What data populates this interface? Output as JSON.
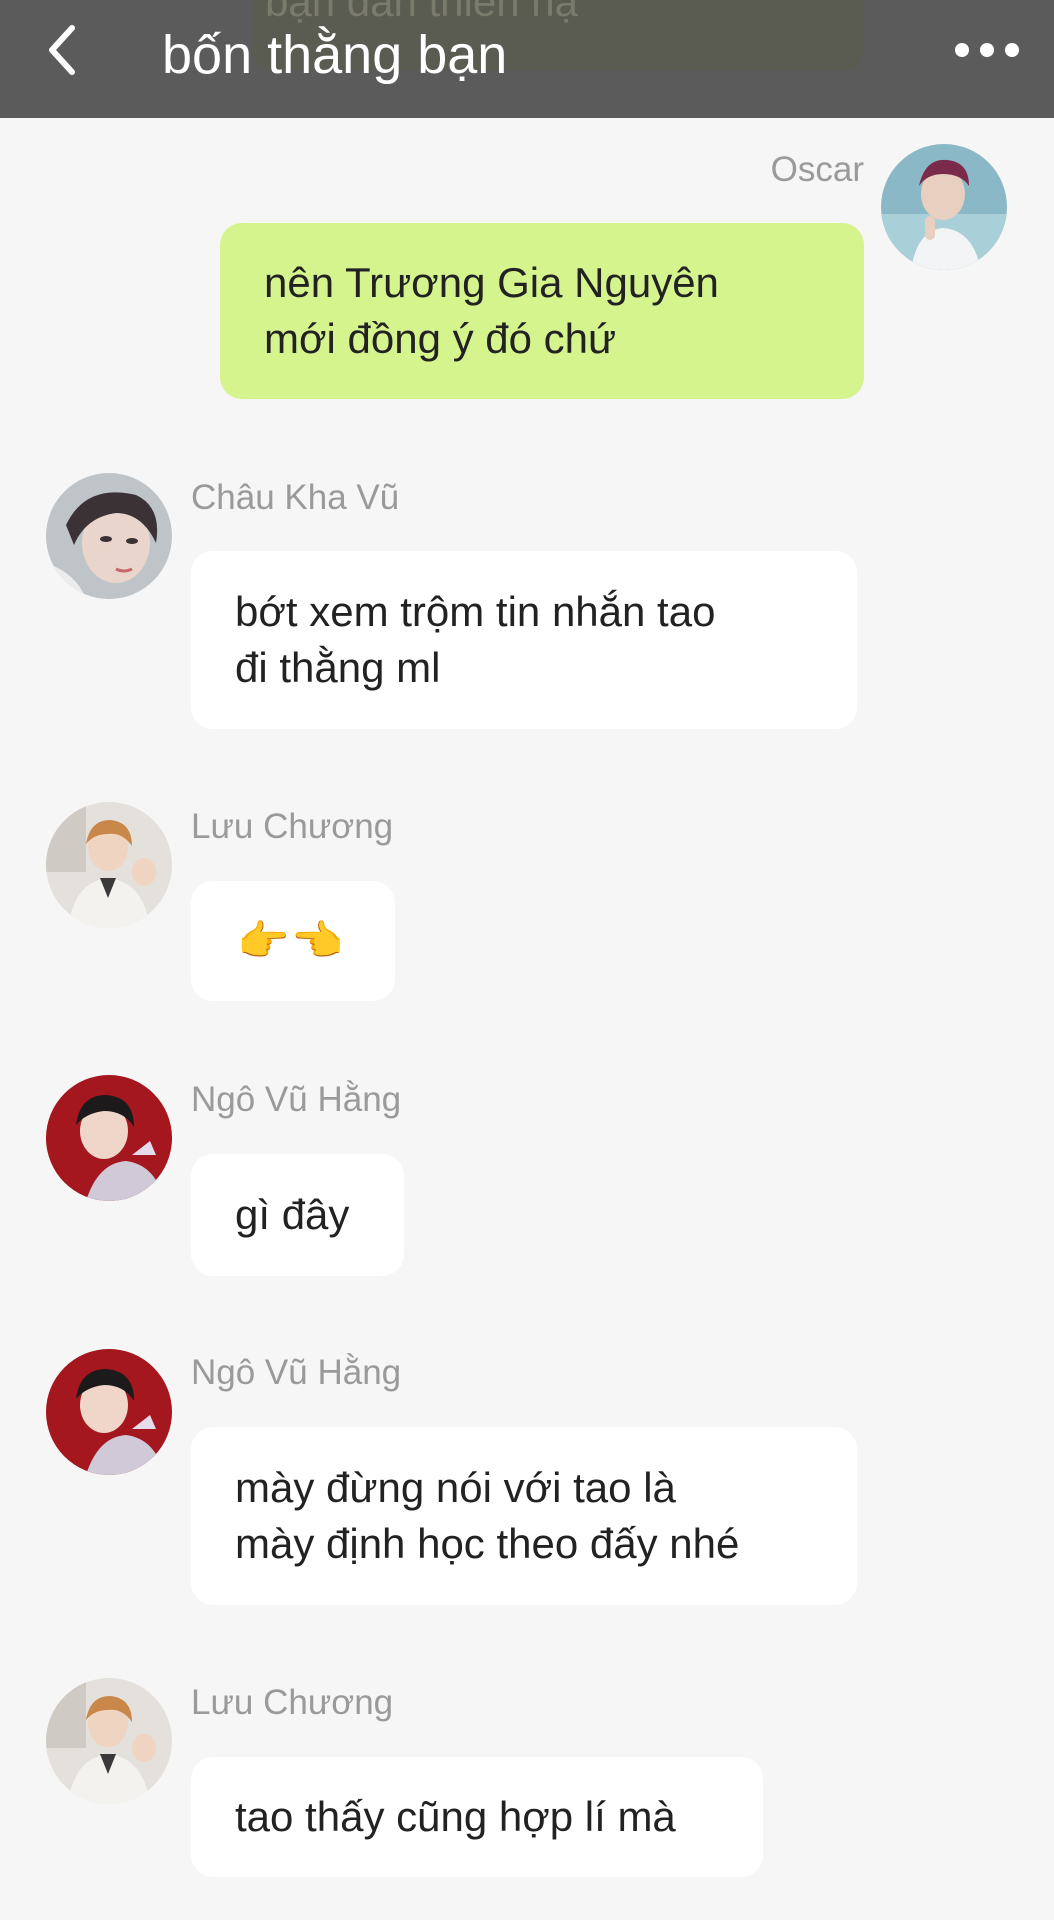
{
  "header": {
    "title": "bốn thằng bạn",
    "ghost_text": "bạn dân thiên hạ",
    "back_icon": "chevron-left-icon",
    "more_icon": "more-horizontal-icon",
    "background": "#5b5b5b"
  },
  "colors": {
    "chat_background": "#f6f6f6",
    "own_bubble": "#d5f48e",
    "other_bubble": "#ffffff",
    "sender_name": "#9a9a9a"
  },
  "messages": [
    {
      "sender": "Oscar",
      "side": "right",
      "text": "nên Trương Gia Nguyên\nmới đồng ý đó chứ"
    },
    {
      "sender": "Châu Kha Vũ",
      "side": "left",
      "text": "bớt xem trộm tin nhắn tao\nđi thằng ml"
    },
    {
      "sender": "Lưu Chương",
      "side": "left",
      "text": "👉👈"
    },
    {
      "sender": "Ngô Vũ Hằng",
      "side": "left",
      "text": "gì đây"
    },
    {
      "sender": "Ngô Vũ Hằng",
      "side": "left",
      "text": "mày đừng nói với tao là\nmày định học theo đấy nhé"
    },
    {
      "sender": "Lưu Chương",
      "side": "left",
      "text": "tao thấy cũng hợp lí mà"
    }
  ]
}
